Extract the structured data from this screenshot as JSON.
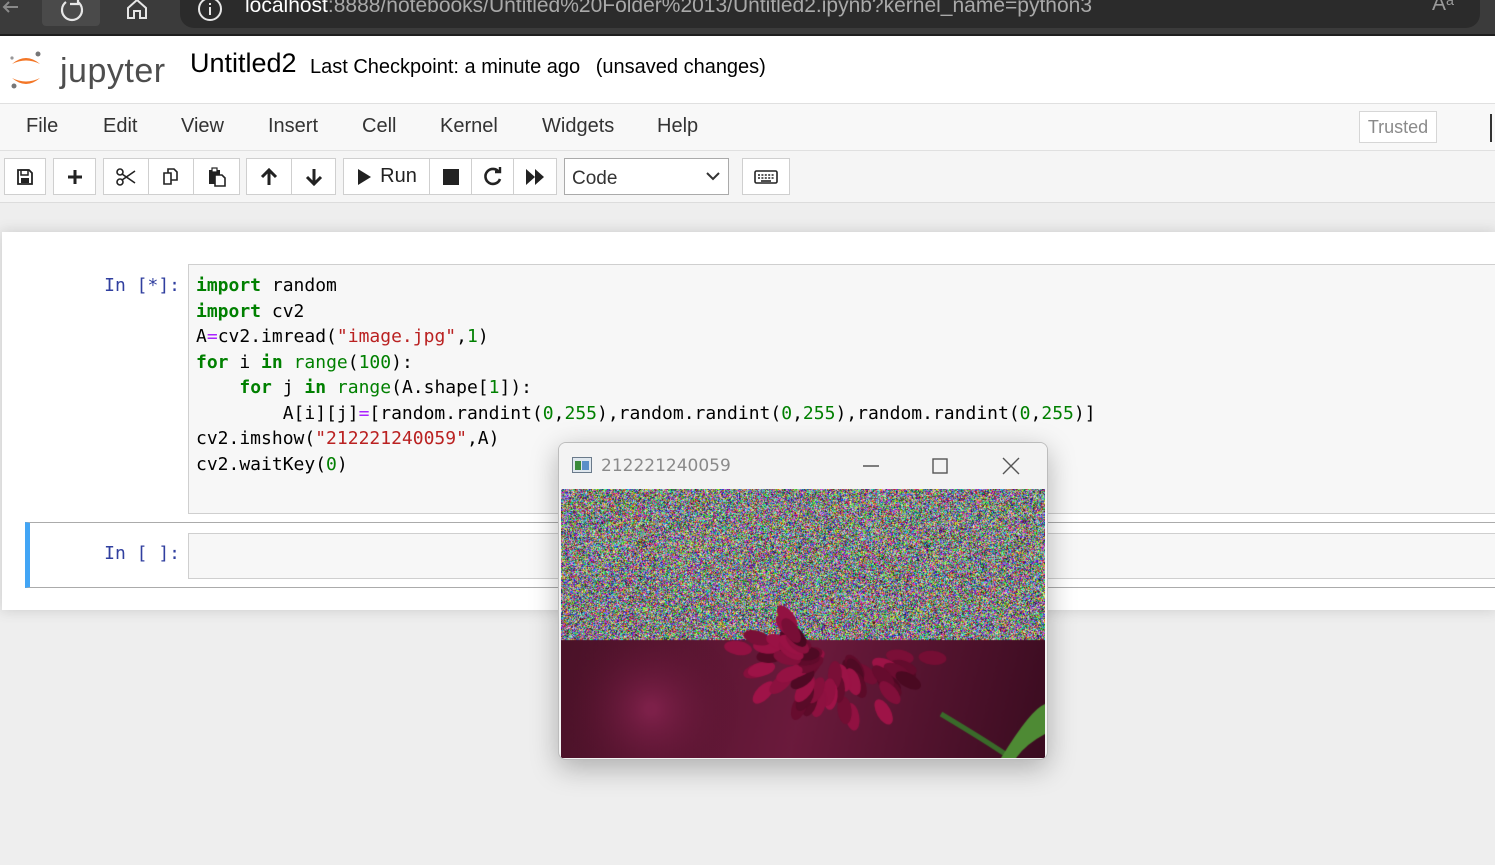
{
  "browser": {
    "url_host": "localhost",
    "url_path": ":8888/notebooks/Untitled%20Folder%2013/Untitled2.ipynb?kernel_name=python3",
    "read_aloud": "Aᵃ"
  },
  "header": {
    "logo_text": "jupyter",
    "notebook_name": "Untitled2",
    "checkpoint": "Last Checkpoint: a minute ago",
    "autosave_status": "(unsaved changes)"
  },
  "menubar": {
    "items": [
      "File",
      "Edit",
      "View",
      "Insert",
      "Cell",
      "Kernel",
      "Widgets",
      "Help"
    ],
    "trusted": "Trusted"
  },
  "toolbar": {
    "run_label": "Run",
    "cell_type": "Code"
  },
  "cells": [
    {
      "prompt": "In [*]:",
      "code_lines": [
        "import random",
        "import cv2",
        "A=cv2.imread(\"image.jpg\",1)",
        "for i in range(100):",
        "    for j in range(A.shape[1]):",
        "        A[i][j]=[random.randint(0,255),random.randint(0,255),random.randint(0,255)]",
        "cv2.imshow(\"212221240059\",A)",
        "cv2.waitKey(0)"
      ]
    },
    {
      "prompt": "In [ ]:",
      "code_lines": []
    }
  ],
  "cv_window": {
    "title": "212221240059"
  },
  "colors": {
    "prompt_blue": "#303f9f",
    "keyword_green": "#008000",
    "string_red": "#ba2121",
    "operator_purple": "#aa22ff",
    "selected_cell_border": "#42a5f5",
    "jupyter_orange": "#f37626"
  },
  "icons": {
    "browser": [
      "back-icon",
      "reload-icon",
      "home-icon",
      "info-icon"
    ],
    "toolbar": [
      "save-icon",
      "plus-icon",
      "cut-icon",
      "copy-icon",
      "paste-icon",
      "arrow-up-icon",
      "arrow-down-icon",
      "play-icon",
      "stop-icon",
      "restart-icon",
      "fast-forward-icon",
      "keyboard-icon"
    ],
    "window": [
      "opencv-app-icon",
      "minimize-icon",
      "maximize-icon",
      "close-icon"
    ]
  }
}
